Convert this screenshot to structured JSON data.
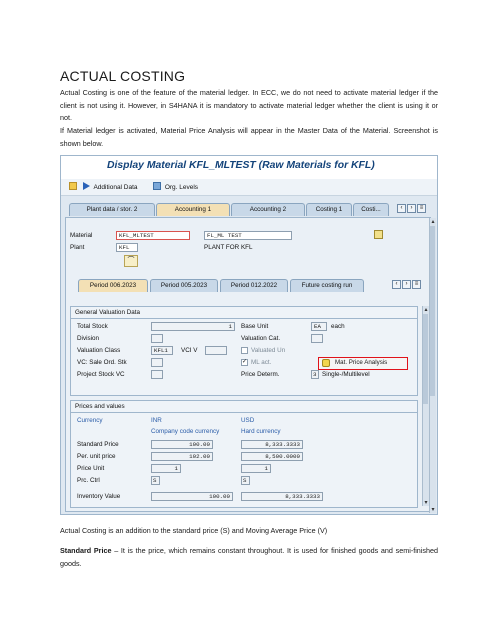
{
  "doc": {
    "title": "ACTUAL COSTING",
    "p1": "Actual Costing is one of the feature of the material ledger. In ECC, we do not need to activate material ledger if the client is not using it. However, in S4HANA it is mandatory to activate material ledger whether the client is using it or not.",
    "p2": "If Material ledger is activated, Material Price Analysis will appear in the Master Data of the Material. Screenshot is shown below.",
    "p3": "Actual Costing is an addition to the standard price (S) and Moving Average Price (V)",
    "p4_bold": "Standard Price",
    "p4_rest": " – It is the price, which remains constant throughout. It is used for finished goods and semi-finished goods."
  },
  "sap": {
    "title": "Display Material KFL_MLTEST (Raw Materials for KFL)",
    "toolbar": {
      "additional_data": "Additional Data",
      "org_levels": "Org. Levels"
    },
    "tabs": [
      "Plant data / stor. 2",
      "Accounting 1",
      "Accounting 2",
      "Costing 1",
      "Costi..."
    ],
    "header": {
      "material_label": "Material",
      "material_value": "KFL_MLTEST",
      "material_desc": "FL_ML TEST",
      "plant_label": "Plant",
      "plant_value": "KFL",
      "plant_desc": "PLANT FOR KFL"
    },
    "periods": [
      "Period 006.2023",
      "Period 005.2023",
      "Period 012.2022",
      "Future costing run"
    ],
    "valuation": {
      "title": "General Valuation Data",
      "total_stock_label": "Total Stock",
      "total_stock_value": "1",
      "base_unit_label": "Base Unit",
      "base_unit_value": "EA",
      "base_unit_text": "each",
      "division_label": "Division",
      "valuation_cat_label": "Valuation Cat.",
      "valuation_class_label": "Valuation Class",
      "valuation_class_value": "KFL1",
      "vci_v_label": "VCI V",
      "valuated_un_label": "Valuated Un",
      "vc_sale_label": "VC: Sale Ord. Stk",
      "ml_act_label": "ML act.",
      "mpa_label": "Mat. Price Analysis",
      "project_stock_label": "Project Stock VC",
      "price_determ_label": "Price Determ.",
      "price_determ_value": "3",
      "price_determ_text": "Single-/Multilevel"
    },
    "prices": {
      "title": "Prices and values",
      "currency_label": "Currency",
      "currency_inr": "INR",
      "currency_usd": "USD",
      "company_code_currency": "Company code currency",
      "hard_currency": "Hard currency",
      "standard_price_label": "Standard Price",
      "standard_price_inr": "100.00",
      "standard_price_usd": "8,333.3333",
      "per_unit_price_label": "Per. unit price",
      "per_unit_price_inr": "102.00",
      "per_unit_price_usd": "8,500.0000",
      "price_unit_label": "Price Unit",
      "price_unit_inr": "1",
      "price_unit_usd": "1",
      "prc_ctrl_label": "Prc. Ctrl",
      "prc_ctrl_inr": "S",
      "prc_ctrl_usd": "S",
      "inventory_value_label": "Inventory Value",
      "inventory_value_inr": "100.00",
      "inventory_value_usd": "8,333.3333"
    }
  }
}
